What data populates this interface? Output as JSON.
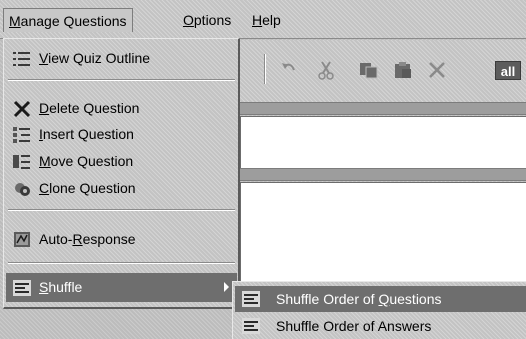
{
  "menubar": {
    "items": [
      {
        "pre": "",
        "mn": "M",
        "post": "anage Questions"
      },
      {
        "pre": "",
        "mn": "O",
        "post": "ptions"
      },
      {
        "pre": "",
        "mn": "H",
        "post": "elp"
      }
    ]
  },
  "toolbar": {
    "icons": [
      "undo-icon",
      "cut-icon",
      "copy-icon",
      "paste-icon",
      "delete-icon"
    ],
    "all_label": "all"
  },
  "dropdown": {
    "items": [
      {
        "pre": "",
        "mn": "V",
        "post": "iew Quiz Outline",
        "icon": "outline-icon"
      },
      {
        "pre": "",
        "mn": "D",
        "post": "elete Question",
        "icon": "delete-icon"
      },
      {
        "pre": "",
        "mn": "I",
        "post": "nsert Question",
        "icon": "insert-icon"
      },
      {
        "pre": "",
        "mn": "M",
        "post": "ove Question",
        "icon": "move-icon"
      },
      {
        "pre": "",
        "mn": "C",
        "post": "lone Question",
        "icon": "clone-icon"
      },
      {
        "pre": "Auto-",
        "mn": "R",
        "post": "esponse",
        "icon": "auto-response-icon"
      },
      {
        "pre": "",
        "mn": "S",
        "post": "huffle",
        "icon": "shuffle-icon"
      }
    ]
  },
  "submenu": {
    "items": [
      {
        "pre": "Shuffle Order of ",
        "mn": "Q",
        "post": "uestions",
        "icon": "shuffle-questions-icon"
      },
      {
        "pre": "Shuffle Order of Answers",
        "mn": "",
        "post": "",
        "icon": "shuffle-answers-icon"
      }
    ]
  }
}
